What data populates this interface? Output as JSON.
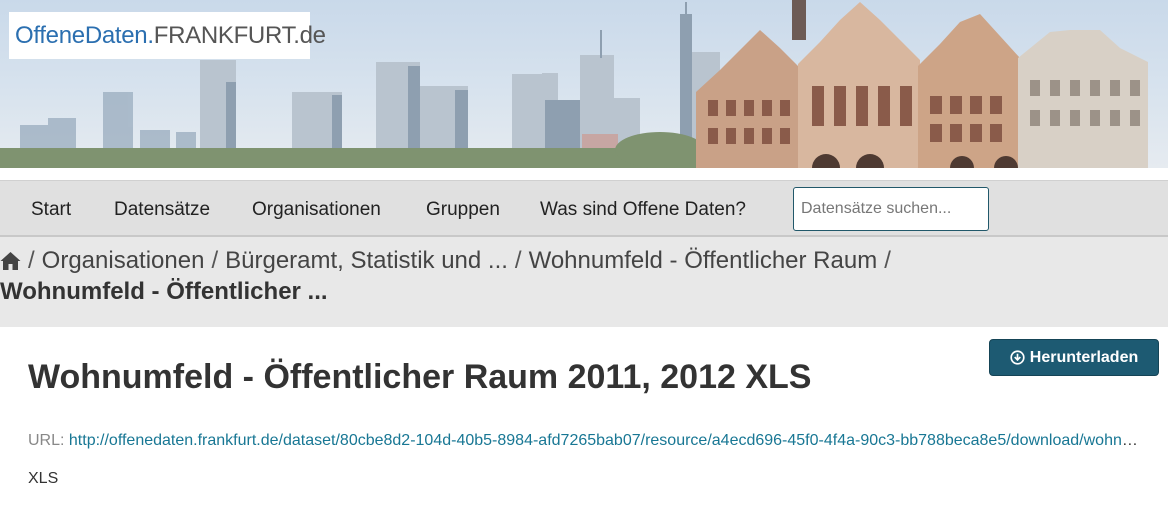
{
  "brand": {
    "part1": "OffeneDaten.",
    "part2": "FRANKFURT.de"
  },
  "nav": {
    "items": [
      {
        "label": "Start"
      },
      {
        "label": "Datensätze"
      },
      {
        "label": "Organisationen"
      },
      {
        "label": "Gruppen"
      },
      {
        "label": "Was sind Offene Daten?"
      }
    ],
    "search_placeholder": "Datensätze suchen..."
  },
  "breadcrumb": {
    "separator": "/",
    "items": [
      {
        "label": "Organisationen"
      },
      {
        "label": "Bürgeramt, Statistik und ..."
      },
      {
        "label": "Wohnumfeld - Öffentlicher Raum"
      }
    ],
    "current": "Wohnumfeld - Öffentlicher ..."
  },
  "resource": {
    "download_label": "Herunterladen",
    "title": "Wohnumfeld - Öffentlicher Raum 2011, 2012 XLS",
    "url_label": "URL:",
    "url": "http://offenedaten.frankfurt.de/dataset/80cbe8d2-104d-40b5-8984-afd7265bab07/resource/a4ecd696-45f0-4f4a-90c3-bb788beca8e5/download/wohnumfeld-offentlicher-raum.xls",
    "format": "XLS"
  },
  "colors": {
    "brand_blue": "#2b6fb0",
    "button": "#1d5a72",
    "link": "#187794",
    "nav_bg": "#e0e0e0",
    "crumb_bg": "#e8e8e8"
  }
}
